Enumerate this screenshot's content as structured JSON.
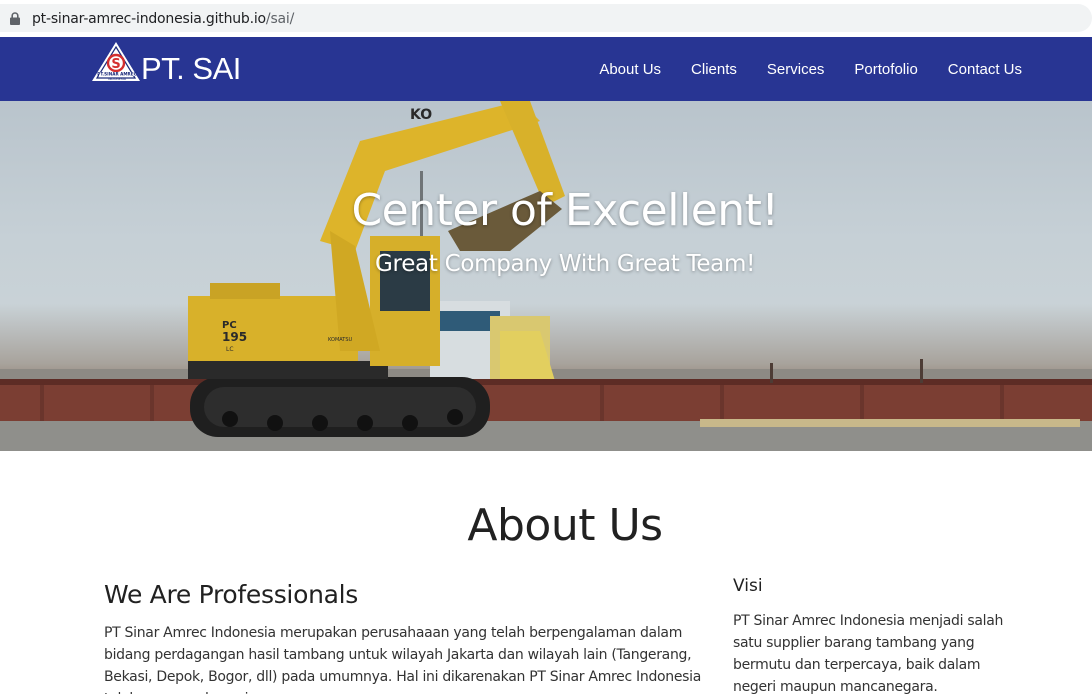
{
  "browser": {
    "url_host": "pt-sinar-amrec-indonesia.github.io",
    "url_path": "/sai/"
  },
  "navbar": {
    "brand": "PT. SAI",
    "logo_text": "PT.SINAR AMREC INDONESIA",
    "items": [
      {
        "label": "About Us"
      },
      {
        "label": "Clients"
      },
      {
        "label": "Services"
      },
      {
        "label": "Portofolio"
      },
      {
        "label": "Contact Us"
      }
    ],
    "background_color": "#283593"
  },
  "hero": {
    "title": "Center of Excellent!",
    "subtitle": "Great Company With Great Team!",
    "excavator_labels": {
      "arm": "KO",
      "model": "PC 195 LC",
      "brand": "KOMATSU"
    }
  },
  "about": {
    "heading": "About Us",
    "left_title": "We Are Professionals",
    "left_text": "PT Sinar Amrec Indonesia merupakan perusahaaan yang telah berpengalaman dalam bidang perdagangan hasil tambang untuk wilayah Jakarta dan wilayah lain (Tangerang, Bekasi, Depok, Bogor, dll) pada umumnya. Hal ini dikarenakan PT Sinar Amrec Indonesia telah mensupply pasir",
    "right_title": "Visi",
    "right_text": "PT Sinar Amrec Indonesia menjadi salah satu supplier barang tambang yang bermutu dan terpercaya, baik dalam negeri maupun mancanegara."
  }
}
